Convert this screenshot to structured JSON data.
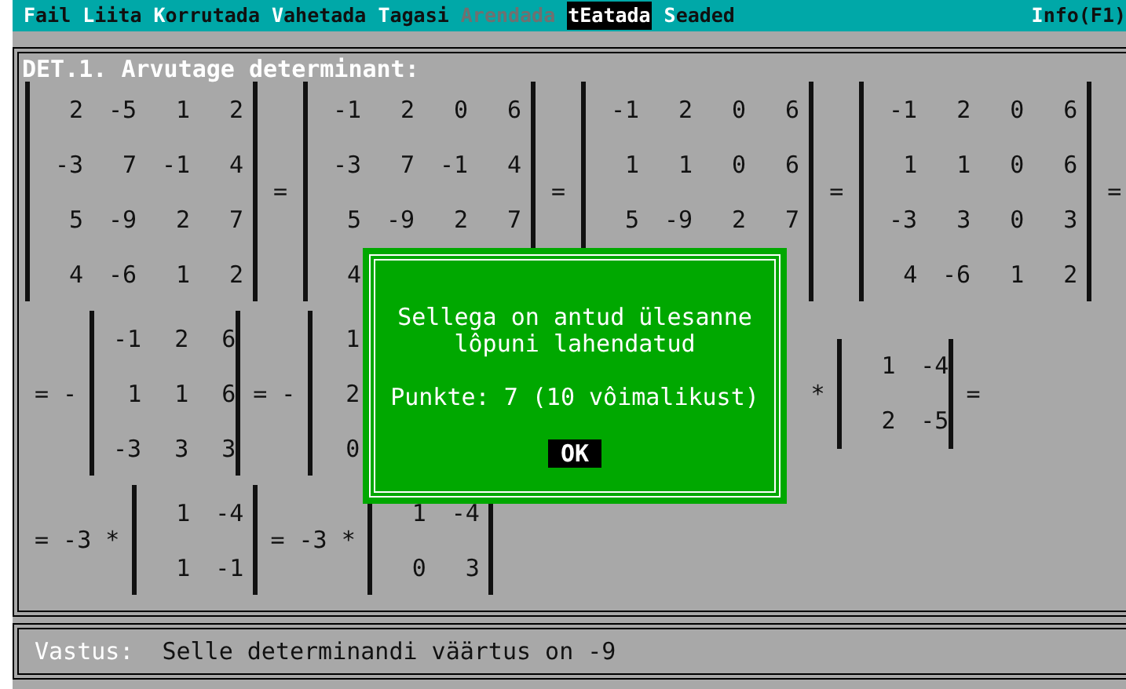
{
  "menu": [
    {
      "label": "Fail",
      "disabled": false,
      "selected": false
    },
    {
      "label": "Liita",
      "disabled": false,
      "selected": false
    },
    {
      "label": "Korrutada",
      "disabled": false,
      "selected": false
    },
    {
      "label": "Vahetada",
      "disabled": false,
      "selected": false
    },
    {
      "label": "Tagasi",
      "disabled": false,
      "selected": false
    },
    {
      "label": "Arendada",
      "disabled": true,
      "selected": false
    },
    {
      "label": "tEatada",
      "disabled": false,
      "selected": true
    },
    {
      "label": "Seaded",
      "disabled": false,
      "selected": false
    }
  ],
  "help": "Info(F1)",
  "panel": {
    "title": "DET.1. Arvutage determinant:",
    "rows": [
      {
        "items": [
          {
            "kind": "det",
            "rows": [
              [
                "2",
                "-5",
                "1",
                "2"
              ],
              [
                "-3",
                "7",
                "-1",
                "4"
              ],
              [
                "5",
                "-9",
                "2",
                "7"
              ],
              [
                "4",
                "-6",
                "1",
                "2"
              ]
            ]
          },
          {
            "kind": "op",
            "text": "="
          },
          {
            "kind": "det",
            "rows": [
              [
                "-1",
                "2",
                "0",
                "6"
              ],
              [
                "-3",
                "7",
                "-1",
                "4"
              ],
              [
                "5",
                "-9",
                "2",
                "7"
              ],
              [
                "4",
                null,
                null,
                null
              ]
            ]
          },
          {
            "kind": "op",
            "text": "="
          },
          {
            "kind": "det",
            "rows": [
              [
                "-1",
                "2",
                "0",
                "6"
              ],
              [
                "1",
                "1",
                "0",
                "6"
              ],
              [
                "5",
                "-9",
                "2",
                "7"
              ],
              [
                null,
                null,
                null,
                null
              ]
            ]
          },
          {
            "kind": "op",
            "text": "="
          },
          {
            "kind": "det",
            "rows": [
              [
                "-1",
                "2",
                "0",
                "6"
              ],
              [
                "1",
                "1",
                "0",
                "6"
              ],
              [
                "-3",
                "3",
                "0",
                "3"
              ],
              [
                "4",
                "-6",
                "1",
                "2"
              ]
            ]
          },
          {
            "kind": "op",
            "text": "="
          }
        ]
      },
      {
        "items": [
          {
            "kind": "op",
            "text": "= -"
          },
          {
            "kind": "det",
            "rows": [
              [
                "-1",
                "2",
                "6"
              ],
              [
                "1",
                "1",
                "6"
              ],
              [
                "-3",
                "3",
                "3"
              ]
            ]
          },
          {
            "kind": "op",
            "text": "= -"
          },
          {
            "kind": "det",
            "rows": [
              [
                "1",
                null,
                null
              ],
              [
                "2",
                null,
                null
              ],
              [
                "0",
                null,
                null
              ]
            ]
          },
          {
            "kind": "op",
            "text": "*"
          },
          {
            "kind": "det",
            "rows": [
              [
                "1",
                "-4"
              ],
              [
                "2",
                "-5"
              ]
            ]
          },
          {
            "kind": "op",
            "text": "="
          }
        ]
      },
      {
        "items": [
          {
            "kind": "op",
            "text": "= -3 *"
          },
          {
            "kind": "det",
            "rows": [
              [
                "1",
                "-4"
              ],
              [
                "1",
                "-1"
              ]
            ]
          },
          {
            "kind": "op",
            "text": "= -3 *"
          },
          {
            "kind": "det",
            "rows": [
              [
                "1",
                "-4"
              ],
              [
                "0",
                "3"
              ]
            ]
          }
        ]
      }
    ]
  },
  "dialog": {
    "lines": [
      "Sellega on antud ülesanne",
      "lôpuni lahendatud"
    ],
    "score": "Punkte: 7 (10 vôimalikust)",
    "button": "OK"
  },
  "answer": {
    "label": "Vastus:",
    "text": "Selle determinandi väärtus on -9"
  }
}
